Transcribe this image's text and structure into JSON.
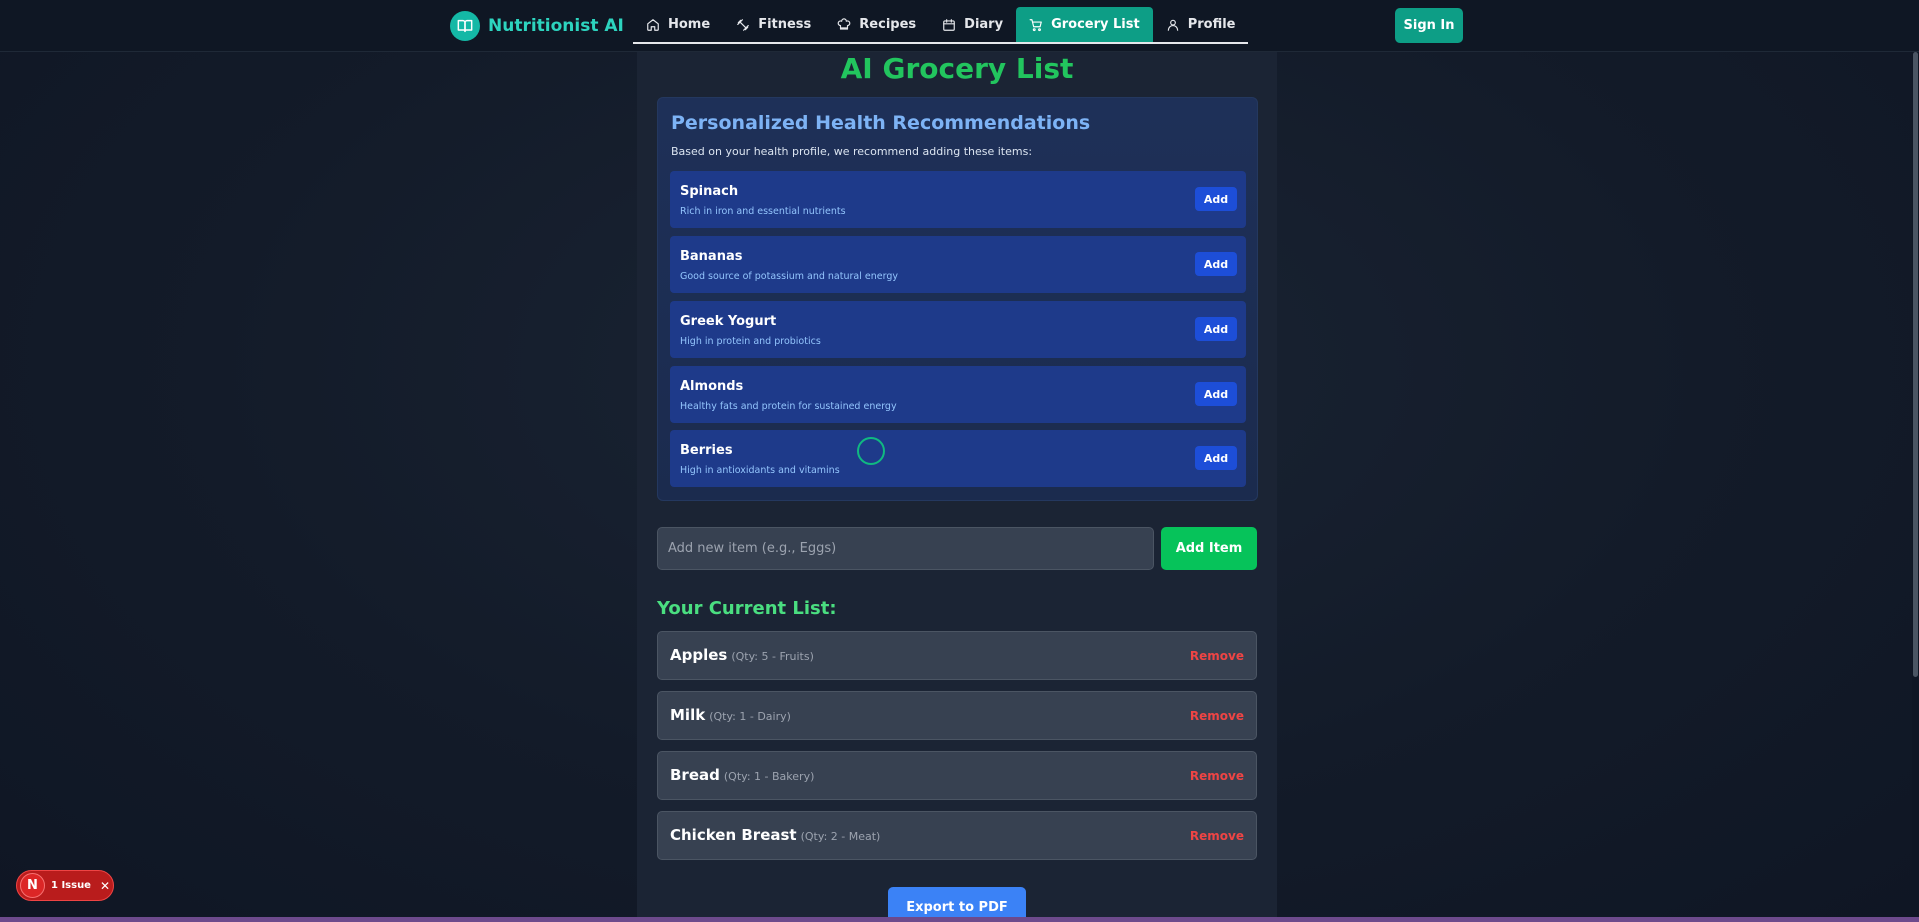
{
  "nav": {
    "brand": "Nutritionist AI",
    "links": [
      {
        "label": "Home",
        "icon": "home-icon"
      },
      {
        "label": "Fitness",
        "icon": "dumbbell-icon"
      },
      {
        "label": "Recipes",
        "icon": "chef-hat-icon"
      },
      {
        "label": "Diary",
        "icon": "calendar-icon"
      },
      {
        "label": "Grocery List",
        "icon": "cart-icon",
        "active": true
      },
      {
        "label": "Profile",
        "icon": "user-icon"
      }
    ],
    "sign_in": "Sign In"
  },
  "page": {
    "title": "AI Grocery List"
  },
  "recommendations": {
    "title": "Personalized Health Recommendations",
    "subtitle": "Based on your health profile, we recommend adding these items:",
    "add_label": "Add",
    "items": [
      {
        "name": "Spinach",
        "desc": "Rich in iron and essential nutrients"
      },
      {
        "name": "Bananas",
        "desc": "Good source of potassium and natural energy"
      },
      {
        "name": "Greek Yogurt",
        "desc": "High in protein and probiotics"
      },
      {
        "name": "Almonds",
        "desc": "Healthy fats and protein for sustained energy"
      },
      {
        "name": "Berries",
        "desc": "High in antioxidants and vitamins"
      }
    ]
  },
  "new_item": {
    "placeholder": "Add new item (e.g., Eggs)",
    "button": "Add Item"
  },
  "current_list": {
    "heading": "Your Current List:",
    "remove_label": "Remove",
    "items": [
      {
        "name": "Apples",
        "meta": "(Qty: 5 - Fruits)"
      },
      {
        "name": "Milk",
        "meta": "(Qty: 1 - Dairy)"
      },
      {
        "name": "Bread",
        "meta": "(Qty: 1 - Bakery)"
      },
      {
        "name": "Chicken Breast",
        "meta": "(Qty: 2 - Meat)"
      }
    ]
  },
  "export_label": "Export to PDF",
  "issue_badge": {
    "letter": "N",
    "text": "1 Issue",
    "close": "✕"
  },
  "colors": {
    "accent": "#0d9e86",
    "brand": "#2dd4bf",
    "title": "#22c55e",
    "danger": "#ef4444",
    "primary": "#3b82f6"
  }
}
